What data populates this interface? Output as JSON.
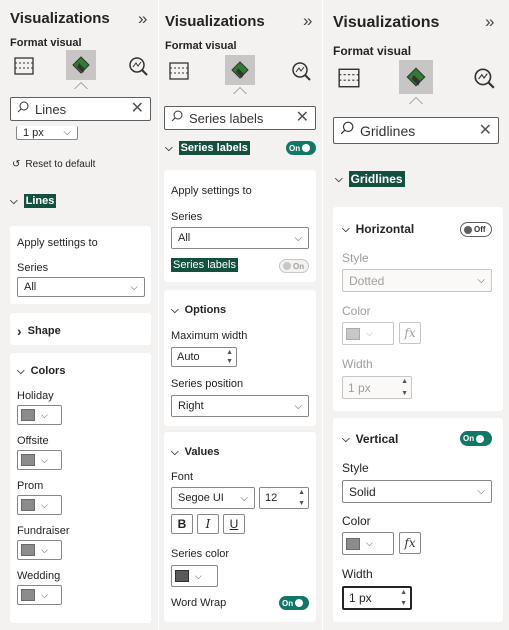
{
  "panel1": {
    "title": "Visualizations",
    "subtitle": "Format visual",
    "search_value": "Lines",
    "prev_value": "1 px",
    "reset_label": "Reset to default",
    "section_label": "Lines",
    "apply_heading": "Apply settings to",
    "series_label": "Series",
    "series_value": "All",
    "shape_label": "Shape",
    "colors_label": "Colors",
    "color_items": [
      {
        "label": "Holiday"
      },
      {
        "label": "Offsite"
      },
      {
        "label": "Prom"
      },
      {
        "label": "Fundraiser"
      },
      {
        "label": "Wedding"
      }
    ]
  },
  "panel2": {
    "title": "Visualizations",
    "subtitle": "Format visual",
    "search_value": "Series labels",
    "section_label": "Series labels",
    "section_toggle": "On",
    "apply_heading": "Apply settings to",
    "series_label": "Series",
    "series_value": "All",
    "series_labels_label": "Series labels",
    "series_labels_toggle": "On",
    "options_label": "Options",
    "max_width_label": "Maximum width",
    "max_width_value": "Auto",
    "series_position_label": "Series position",
    "series_position_value": "Right",
    "values_label": "Values",
    "font_label": "Font",
    "font_value": "Segoe UI",
    "font_size": "12",
    "bold": "B",
    "italic": "I",
    "underline": "U",
    "series_color_label": "Series color",
    "word_wrap_label": "Word Wrap",
    "word_wrap_toggle": "On"
  },
  "panel3": {
    "title": "Visualizations",
    "subtitle": "Format visual",
    "search_value": "Gridlines",
    "section_label": "Gridlines",
    "horizontal_label": "Horizontal",
    "horizontal_toggle": "Off",
    "h_style_label": "Style",
    "h_style_value": "Dotted",
    "h_color_label": "Color",
    "h_width_label": "Width",
    "h_width_value": "1 px",
    "vertical_label": "Vertical",
    "vertical_toggle": "On",
    "v_style_label": "Style",
    "v_style_value": "Solid",
    "v_color_label": "Color",
    "v_width_label": "Width",
    "v_width_value": "1 px"
  },
  "icons": {
    "fx": "fx",
    "collapse": "»",
    "chevron_down": "⌵",
    "chevron_right": "›"
  },
  "colors": {
    "accent": "#117865",
    "highlight": "#135040",
    "swatch": "#8c8c8c"
  }
}
